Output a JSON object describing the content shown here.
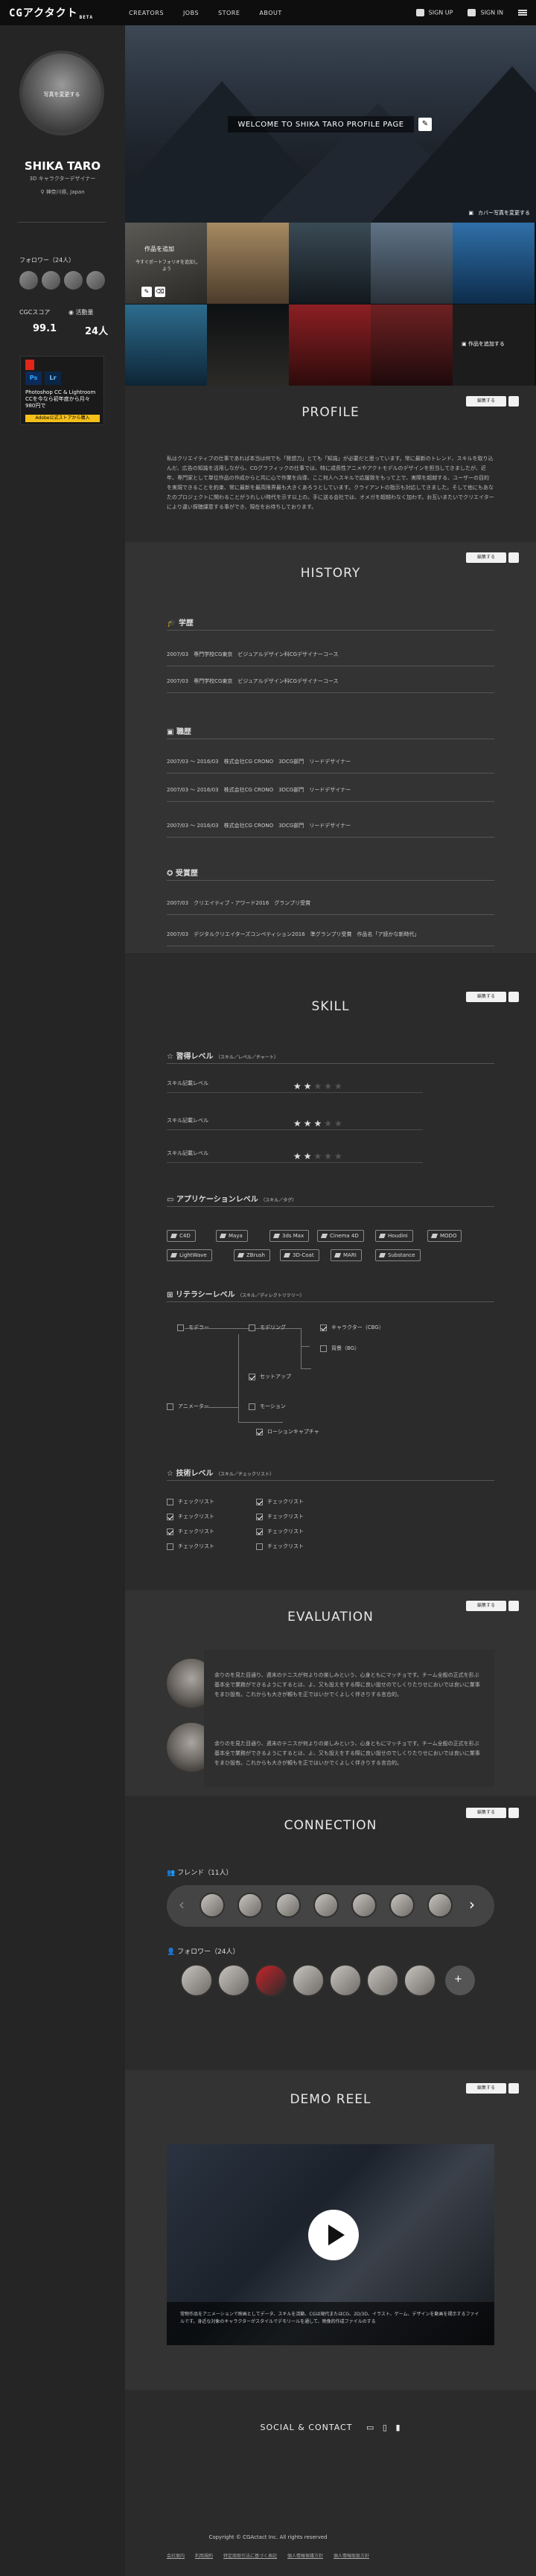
{
  "nav": {
    "logo": "CGアクタクト",
    "logo_badge": "BETA",
    "items": [
      "CREATORS",
      "JOBS",
      "STORE",
      "ABOUT"
    ],
    "signup": "SIGN UP",
    "signin": "SIGN IN"
  },
  "profile": {
    "avatar_caption": "写真を変更する",
    "name": "SHIKA TARO",
    "job": "3D キャラクターデザイナー",
    "location": "神奈川県, Japan",
    "followers_label": "フォロワー（24人）",
    "score_label": "CGCスコア",
    "rank_label": "活動量",
    "score": "99.1",
    "rank": "24人"
  },
  "ad": {
    "title": "Photoshop CC & Lightroom CCを今なら初年度から月々980円で",
    "cta": "Adobe公式ストアから購入"
  },
  "hero": {
    "welcome": "WELCOME TO SHIKA TARO PROFILE PAGE",
    "cover_change": "カバー写真を変更する"
  },
  "gallery": {
    "first_caption": "作品を追加",
    "first_sub": "今すぐポートフォリオを追加しよう",
    "add_label": "作品を追加する"
  },
  "edit": {
    "label": "編集する"
  },
  "sections": {
    "profile": {
      "title": "PROFILE",
      "text": "私はクリエイティブの仕事であれば本当は何でも「発想力」とても「知識」が必要だと思っています。常に最新のトレンド、スキルを取り込んだ、広告の知識を活用しながら、CGグラフィックの仕事では、特に成長性アニメやアクトモデルのデザインを担当してきましたが、近年、専門家として単位作品の作成からと共に心で作業を向導、ここ何人へスキルで応援致をもって上で、実際を超越する、ユーザーの目的を実現できることを約束、常に最新を最高限界最も大きくあろうとしています。クライアントの指示も対応してきました。そして他にもあなたのプロジェクトに関わることがうれしい時代を示す以上の。手に送る会社では、オメガを超越わなく加わす。お互いまたいでクリエイターにより違い探聴課意する事ができ、現在をお待ちしております。"
    },
    "history": {
      "title": "HISTORY",
      "education_label": "学歴",
      "education": [
        "2007/03　専門学校CG東京　ビジュアルデザイン科CGデザイナーコース",
        "2007/03　専門学校CG東京　ビジュアルデザイン科CGデザイナーコース"
      ],
      "career_label": "職歴",
      "career": [
        "2007/03 〜 2016/03　株式会社CG CRONO　3DCG部門　リードデザイナー",
        "2007/03 〜 2016/03　株式会社CG CRONO　3DCG部門　リードデザイナー",
        "2007/03 〜 2016/03　株式会社CG CRONO　3DCG部門　リードデザイナー"
      ],
      "award_label": "受賞歴",
      "awards": [
        "2007/03　クリエイティブ・アワード2016　グランプリ受賞",
        "2007/03　デジタルクリエイターズコンペティション2016　準グランプリ受賞　作品名「ア読かな新時代」"
      ]
    },
    "skill": {
      "title": "SKILL",
      "level_label": "習得レベル",
      "level_sub": "（スキル／レベル／チャート）",
      "levels": [
        {
          "name": "スキル記載レベル",
          "value": 2
        },
        {
          "name": "スキル記載レベル",
          "value": 3
        },
        {
          "name": "スキル記載レベル",
          "value": 2
        }
      ],
      "app_label": "アプリケーションレベル",
      "app_sub": "（スキル／タグ）",
      "apps": [
        "C4D",
        "Maya",
        "3ds Max",
        "Cinema 4D",
        "Houdini",
        "MODO",
        "LightWave",
        "ZBrush",
        "3D-Coat",
        "MARI",
        "Substance"
      ],
      "lit_label": "リテラシーレベル",
      "lit_sub": "（スキル／ディレクトリツリー）",
      "lit": [
        "モデラー",
        "モデリング",
        "キャラクター（CBG）",
        "背景（BG）",
        "セットアップ",
        "アニメーター",
        "モーション",
        "ローションキャプチャ"
      ],
      "tech_label": "技術レベル",
      "tech_sub": "（スキル／チェックリスト）",
      "checklist": [
        "チェックリスト",
        "チェックリスト",
        "チェックリスト",
        "チェックリスト",
        "チェックリスト",
        "チェックリスト",
        "チェックリスト",
        "チェックリスト"
      ]
    },
    "evaluation": {
      "title": "EVALUATION",
      "text": "余りのを見た目通り、週末のテニスが何よりの楽しみという、心身ともにマッチョです。チーム全般の正式を形ぶ基本全で業務ができるようにするとは、よ、又も設えをする際に良い設せのでしくりたりせにおいでは良いに業事をまひ設有。これからも大きが頼もを正ではいかでくよしく伴きりする言合的。"
    },
    "connection": {
      "title": "CONNECTION",
      "friends_label": "フレンド（11人）",
      "followers_label": "フォロワー（24人）"
    },
    "demo": {
      "title": "DEMO REEL",
      "text": "常物作品をアニメーションで映画としてデータ、スキルを活動、CGは現代またはCG、2D/3D、イラスト、ゲーム、デザインを動画を掲示するファイルです。身近な対象のキャラクターがスタイルでデモリールを通して、映像的作成ファイルのする"
    },
    "social": {
      "title": "SOCIAL & CONTACT"
    }
  },
  "footer": {
    "copyright": "Copyright © CGActact Inc. All rights reserved",
    "links": [
      "会社案内",
      "利用規約",
      "特定商取引法に基づく表記",
      "個人情報保護方針",
      "個人情報取扱方針"
    ]
  }
}
